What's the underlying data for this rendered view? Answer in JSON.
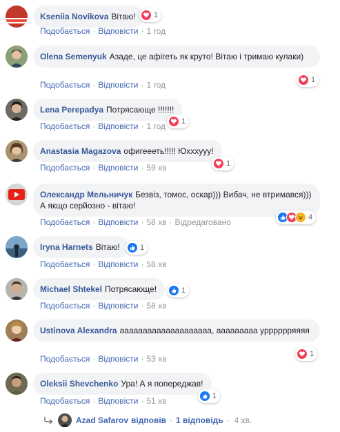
{
  "actions": {
    "like": "Подобається",
    "reply": "Відповісти",
    "edited": "Відредаговано"
  },
  "comments": [
    {
      "author": "Kseniia Novikova",
      "text": "Вітаю!",
      "time": "1 год",
      "reaction_count": "1",
      "reactions": [
        "love"
      ]
    },
    {
      "author": "Olena Semenyuk",
      "text": "Азаде, це афігеть як круто! Вітаю і тримаю кулаки)",
      "time": "1 год",
      "reaction_count": "1",
      "reactions": [
        "love"
      ]
    },
    {
      "author": "Lena Perepadya",
      "text": "Потрясающе !!!!!!!",
      "time": "1 год",
      "reaction_count": "1",
      "reactions": [
        "love"
      ]
    },
    {
      "author": "Anastasia Magazova",
      "text": "офигеееть!!!!! Юхххууу!",
      "time": "59 хв",
      "reaction_count": "1",
      "reactions": [
        "love"
      ]
    },
    {
      "author": "Олександр Мельничук",
      "text": "Безвіз, томос, оскар))) Вибач, не втримався))) А якщо серйозно - вітаю!",
      "time": "58 хв",
      "edited": true,
      "reaction_count": "4",
      "reactions": [
        "like",
        "love",
        "haha"
      ]
    },
    {
      "author": "Iryna Harnets",
      "text": "Вітаю!",
      "time": "58 хв",
      "reaction_count": "1",
      "reactions": [
        "like"
      ]
    },
    {
      "author": "Michael Shtekel",
      "text": "Потрясающе!",
      "time": "58 хв",
      "reaction_count": "1",
      "reactions": [
        "like"
      ]
    },
    {
      "author": "Ustinova Alexandra",
      "text": "аааааааааааааааааааа, ааааааааа урррррряяяя",
      "time": "53 хв",
      "reaction_count": "1",
      "reactions": [
        "love"
      ]
    },
    {
      "author": "Oleksii Shevchenko",
      "text": "Ура! А я попереджав!",
      "time": "51 хв",
      "reaction_count": "1",
      "reactions": [
        "like"
      ]
    }
  ],
  "replies": {
    "author": "Azad Safarov",
    "action": "відповів",
    "count": "1 відповідь",
    "time": "4 хв."
  },
  "colors": {
    "author": "#385898",
    "link": "#4267b2",
    "muted": "#90949c",
    "bubble": "#f2f3f5",
    "love": "#f33e58",
    "like": "#1877f2",
    "haha": "#f7b125"
  }
}
